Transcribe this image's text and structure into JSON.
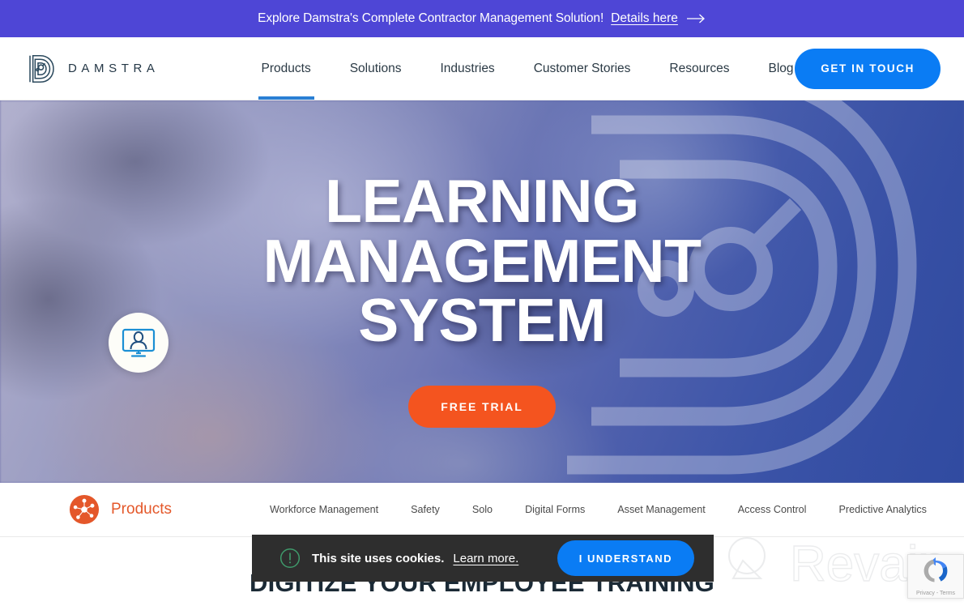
{
  "promo_banner": {
    "text": "Explore Damstra's Complete Contractor Management Solution!",
    "link_label": "Details here",
    "arrow_icon": "arrow-right-icon",
    "background_color": "#4e46d6"
  },
  "navbar": {
    "logo_icon": "damstra-d-logo-icon",
    "brand_name": "DAMSTRA",
    "links": [
      {
        "label": "Products",
        "active": true
      },
      {
        "label": "Solutions",
        "active": false
      },
      {
        "label": "Industries",
        "active": false
      },
      {
        "label": "Customer Stories",
        "active": false
      },
      {
        "label": "Resources",
        "active": false
      },
      {
        "label": "Blog",
        "active": false
      }
    ],
    "cta_label": "GET IN TOUCH",
    "cta_color": "#0a7cf4",
    "active_underline_color": "#2a7fd4"
  },
  "hero": {
    "badge_icon": "elearning-monitor-person-icon",
    "title_line1": "LEARNING MANAGEMENT",
    "title_line2": "SYSTEM",
    "cta_label": "FREE TRIAL",
    "cta_color": "#f4541f",
    "watermark_icon": "damstra-d-watermark-icon"
  },
  "subnav": {
    "icon": "products-network-icon",
    "label": "Products",
    "label_color": "#e4582a",
    "links": [
      {
        "label": "Workforce Management"
      },
      {
        "label": "Safety"
      },
      {
        "label": "Solo"
      },
      {
        "label": "Digital Forms"
      },
      {
        "label": "Asset Management"
      },
      {
        "label": "Access Control"
      },
      {
        "label": "Predictive Analytics"
      }
    ]
  },
  "section_below": {
    "heading": "DIGITIZE YOUR EMPLOYEE TRAINING"
  },
  "cookie_banner": {
    "icon": "alert-circle-icon",
    "icon_color": "#3f9a6b",
    "message": "This site uses cookies.",
    "learn_more_label": "Learn more.",
    "accept_label": "I UNDERSTAND",
    "accept_color": "#0a7cf4",
    "background_color": "#2e2e2e"
  },
  "recaptcha": {
    "icon": "recaptcha-logo-icon",
    "terms_label": "Privacy - Terms"
  },
  "watermark": {
    "logo_icon": "revain-magnifier-icon",
    "word": "Revain"
  }
}
